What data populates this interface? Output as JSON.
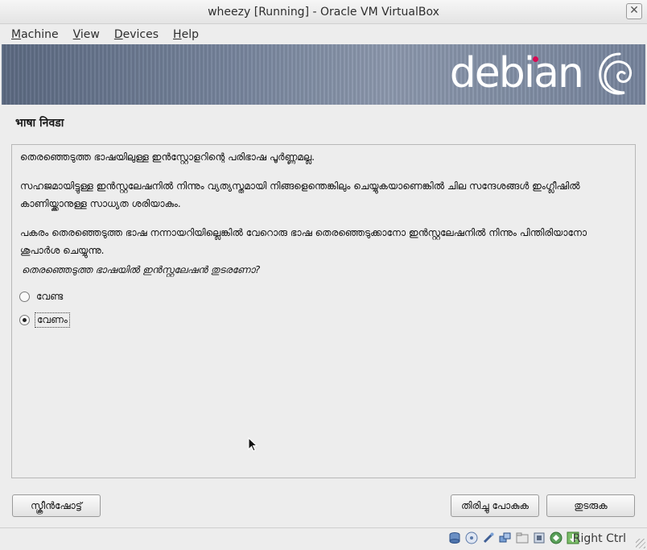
{
  "window": {
    "title": "wheezy [Running] - Oracle VM VirtualBox",
    "close_icon": "close-icon"
  },
  "menubar": {
    "items": [
      {
        "label": "Machine",
        "mnemonic": "M",
        "rest": "achine"
      },
      {
        "label": "View",
        "mnemonic": "V",
        "rest": "iew"
      },
      {
        "label": "Devices",
        "mnemonic": "D",
        "rest": "evices"
      },
      {
        "label": "Help",
        "mnemonic": "H",
        "rest": "elp"
      }
    ]
  },
  "installer": {
    "banner": {
      "brand": "debian",
      "logo_icon": "debian-swirl-icon",
      "dot_color": "#d70a53"
    },
    "page_title": "भाषा निवडा",
    "paragraphs": [
      "തെരഞ്ഞെടുത്ത ഭാഷയിലുള്ള ഇന്‍സ്റ്റോളറിന്റെ പരിഭാഷ പൂര്‍ണ്ണമല്ല.",
      "സഹജമായിട്ടുള്ള ഇന്‍സ്റ്റലേഷനില്‍ നിന്നും വ്യത്യസ്തമായി നിങ്ങളെന്തെങ്കിലും ചെയ്യുകയാണെങ്കില്‍ ചില സന്ദേശങ്ങള്‍ ഇംഗ്ലീഷില്‍ കാണിയ്ക്കാനുള്ള സാധ്യത ശരിയാകും.",
      "പകരം തെരഞ്ഞെടുത്ത ഭാഷ നന്നായറിയില്ലെങ്കില്‍ വേറൊരു ഭാഷ തെരഞ്ഞെടുക്കാനോ ഇന്‍സ്റ്റലേഷനില്‍ നിന്നും പിന്തിരിയാനോ ശുപാര്‍ശ ചെയ്യുന്നു."
    ],
    "question": "തെരഞ്ഞെടുത്ത ഭാഷയില്‍ ഇന്‍സ്റ്റലേഷന്‍ തുടരണോ?",
    "options": [
      {
        "label": "വേണ്ട",
        "selected": false
      },
      {
        "label": "വേണം",
        "selected": true
      }
    ],
    "buttons": {
      "screenshot": "സ്ക്രീന്‍ഷോട്ട്",
      "go_back": "തിരിച്ചു പോകുക",
      "continue": "തുടരുക"
    }
  },
  "statusbar": {
    "icons": [
      "hard-disk-icon",
      "optical-disc-icon",
      "usb-icon",
      "network-icon",
      "shared-folder-icon",
      "video-capture-icon",
      "virtualization-icon",
      "mouse-integration-icon"
    ],
    "host_key": "Right Ctrl"
  }
}
